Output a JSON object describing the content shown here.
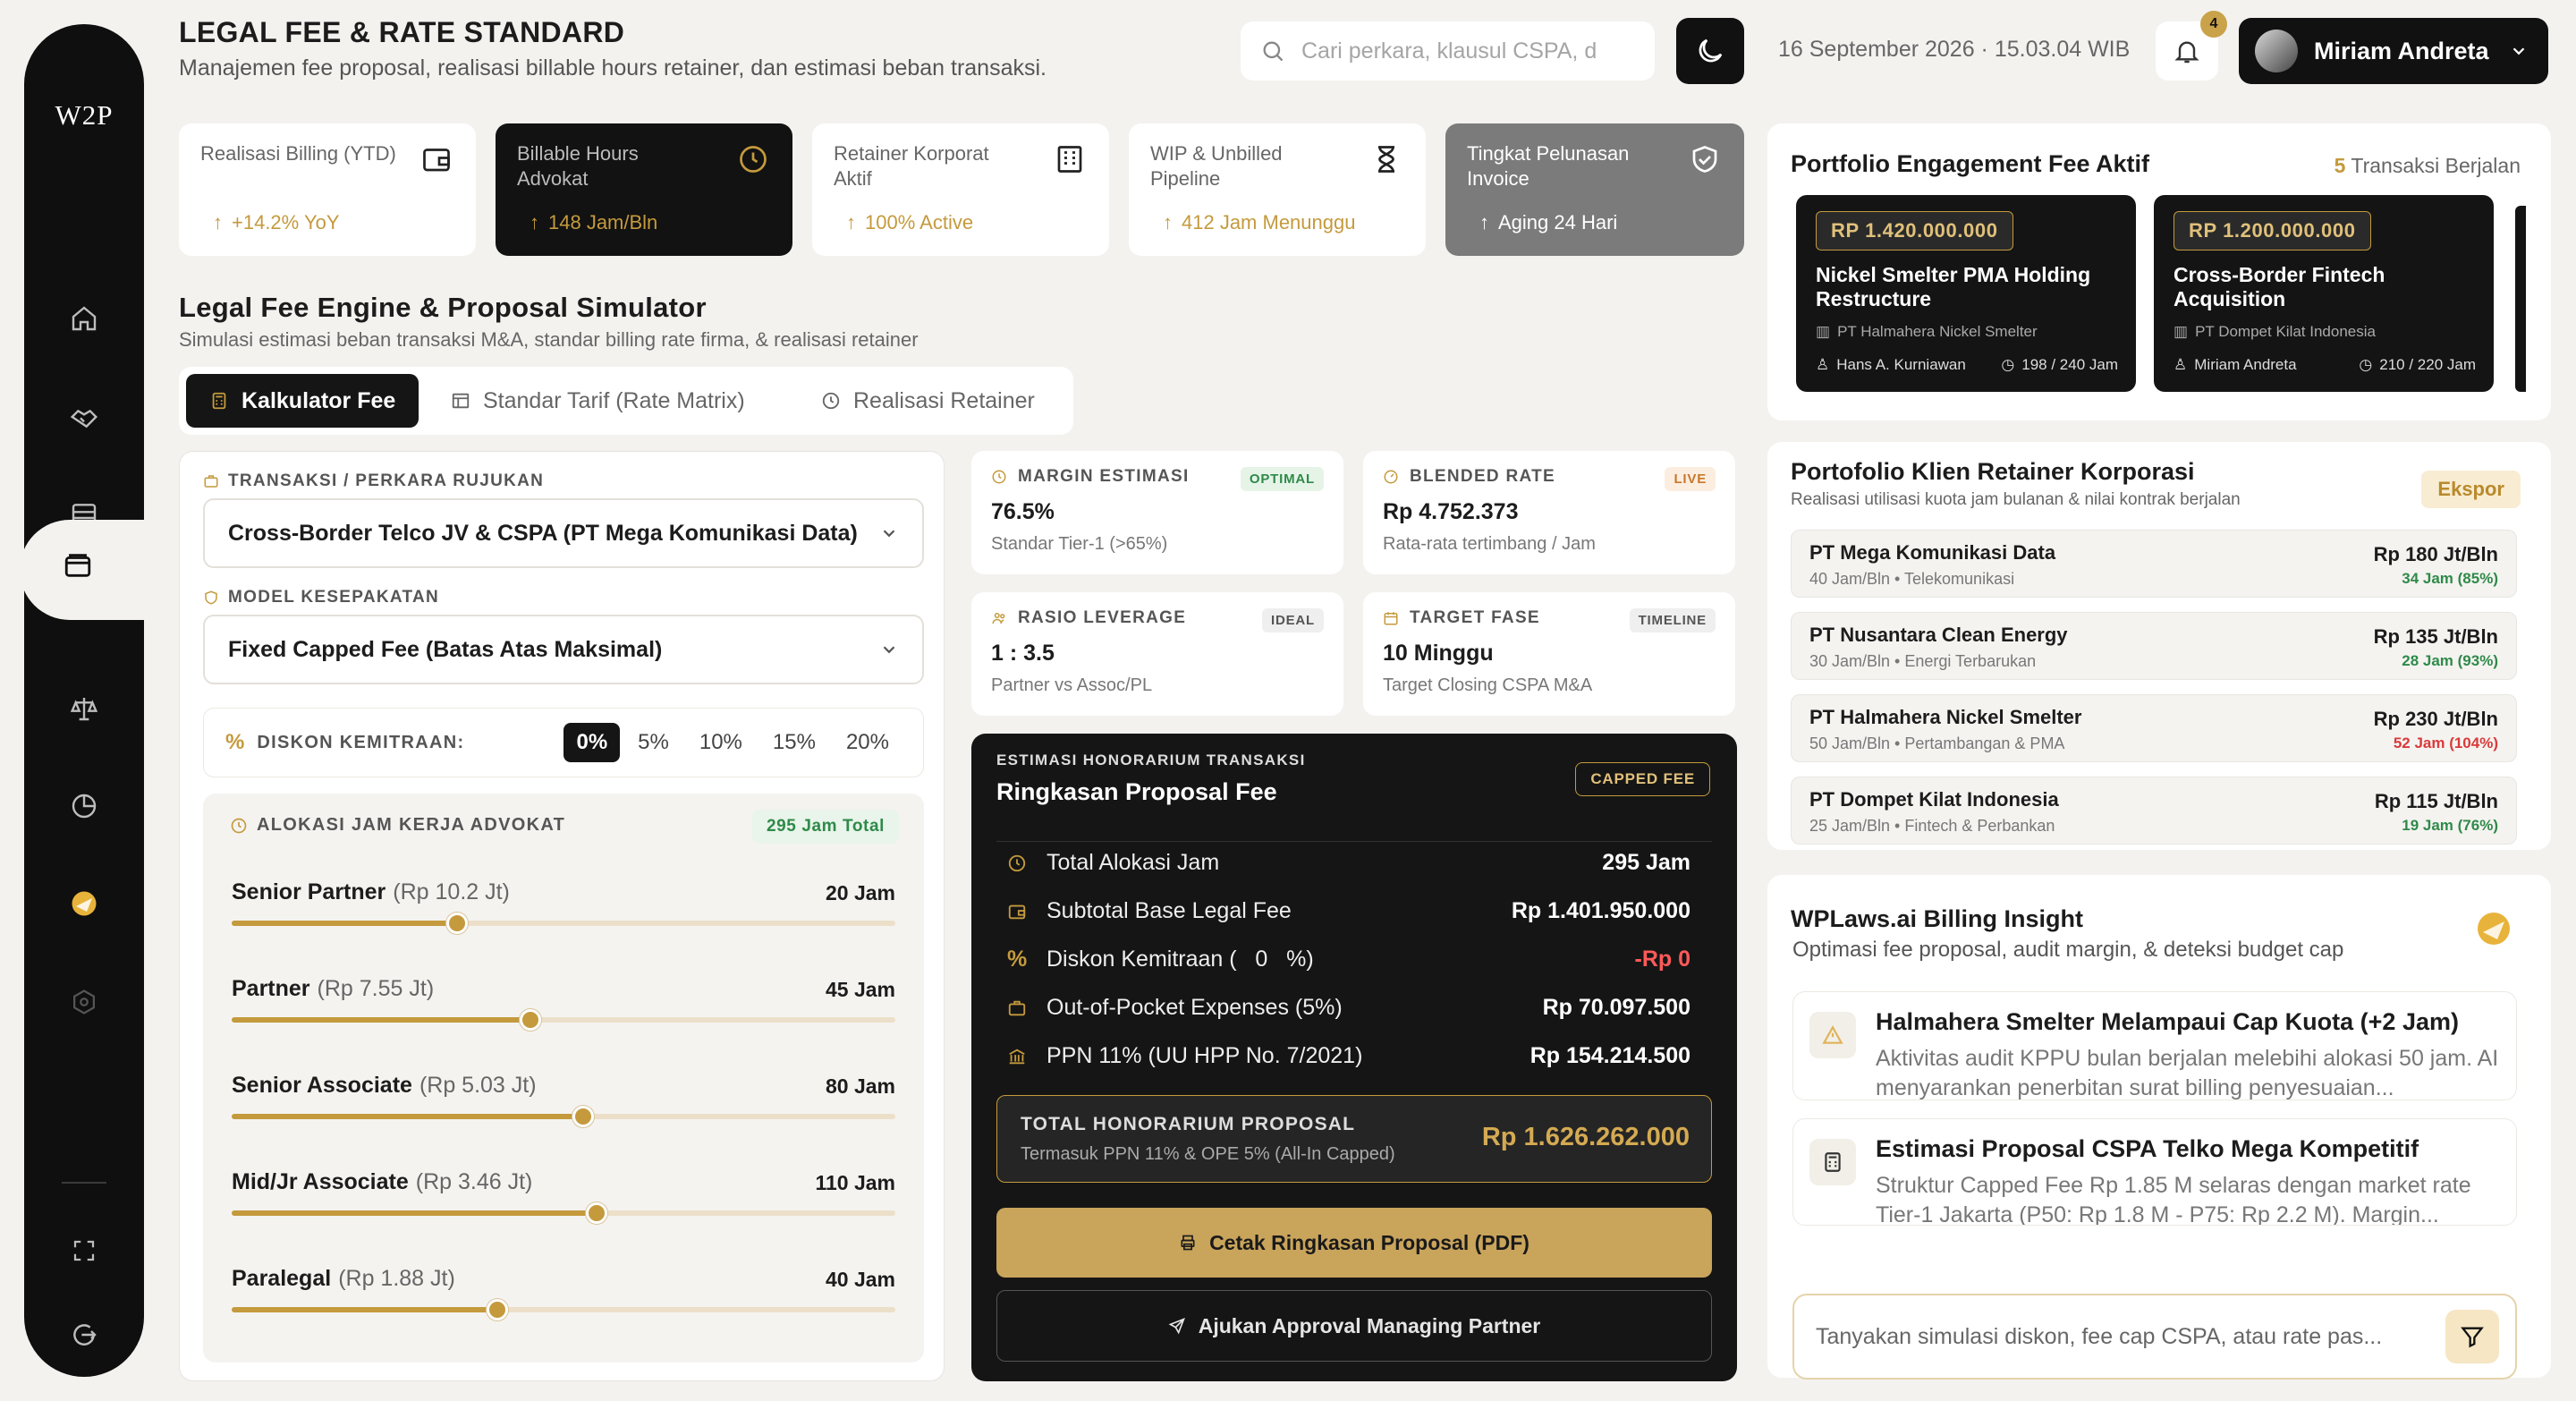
{
  "app": {
    "logo": "W2P"
  },
  "header": {
    "title": "LEGAL FEE & RATE STANDARD",
    "subtitle": "Manajemen fee proposal, realisasi billable hours retainer, dan estimasi beban transaksi.",
    "search_placeholder": "Cari perkara, klausul CSPA, d",
    "datetime": "16 September 2026 · 15.03.04 WIB",
    "notif_count": "4",
    "user_name": "Miriam Andreta"
  },
  "kpis": [
    {
      "label": "Realisasi Billing (YTD)",
      "value": "+14.2% YoY",
      "icon": "wallet-icon"
    },
    {
      "label": "Billable Hours Advokat",
      "value": "148 Jam/Bln",
      "icon": "clock-icon"
    },
    {
      "label": "Retainer Korporat Aktif",
      "value": "100% Active",
      "icon": "building-icon"
    },
    {
      "label": "WIP & Unbilled Pipeline",
      "value": "412 Jam Menunggu",
      "icon": "hourglass-icon"
    },
    {
      "label": "Tingkat Pelunasan Invoice",
      "value": "Aging 24 Hari",
      "icon": "shield-check-icon"
    }
  ],
  "engine": {
    "title": "Legal Fee Engine & Proposal Simulator",
    "subtitle": "Simulasi estimasi beban transaksi M&A, standar billing rate firma, & realisasi retainer",
    "tabs": [
      {
        "label": "Kalkulator Fee",
        "active": true
      },
      {
        "label": "Standar Tarif (Rate Matrix)",
        "active": false
      },
      {
        "label": "Realisasi Retainer",
        "active": false
      }
    ]
  },
  "form": {
    "transaction_label": "TRANSAKSI / PERKARA RUJUKAN",
    "transaction_value": "Cross-Border Telco JV & CSPA (PT Mega Komunikasi Data)",
    "model_label": "MODEL KESEPAKATAN",
    "model_value": "Fixed Capped Fee (Batas Atas Maksimal)",
    "discount_label": "DISKON KEMITRAAN:",
    "discount_options": [
      "0%",
      "5%",
      "10%",
      "15%",
      "20%"
    ],
    "discount_selected": "0%",
    "alloc_label": "ALOKASI JAM KERJA ADVOKAT",
    "alloc_total": "295 Jam Total",
    "roles": [
      {
        "name": "Senior Partner",
        "rate": "(Rp 10.2 Jt)",
        "hours": "20 Jam",
        "level": 0.34
      },
      {
        "name": "Partner",
        "rate": "(Rp 7.55 Jt)",
        "hours": "45 Jam",
        "level": 0.45
      },
      {
        "name": "Senior Associate",
        "rate": "(Rp 5.03 Jt)",
        "hours": "80 Jam",
        "level": 0.53
      },
      {
        "name": "Mid/Jr Associate",
        "rate": "(Rp 3.46 Jt)",
        "hours": "110 Jam",
        "level": 0.55
      },
      {
        "name": "Paralegal",
        "rate": "(Rp 1.88 Jt)",
        "hours": "40 Jam",
        "level": 0.4
      }
    ]
  },
  "metrics": [
    {
      "label": "MARGIN ESTIMASI",
      "badge": "OPTIMAL",
      "value": "76.5%",
      "sub": "Standar Tier-1 (>65%)"
    },
    {
      "label": "BLENDED RATE",
      "badge": "LIVE",
      "value": "Rp 4.752.373",
      "sub": "Rata-rata tertimbang / Jam"
    },
    {
      "label": "RASIO LEVERAGE",
      "badge": "IDEAL",
      "value": "1 : 3.5",
      "sub": "Partner vs Assoc/PL"
    },
    {
      "label": "TARGET FASE",
      "badge": "TIMELINE",
      "value": "10 Minggu",
      "sub": "Target Closing CSPA M&A"
    }
  ],
  "summary": {
    "kicker": "ESTIMASI HONORARIUM TRANSAKSI",
    "title": "Ringkasan Proposal Fee",
    "badge": "CAPPED FEE",
    "rows": [
      {
        "label": "Total Alokasi Jam",
        "value": "295 Jam",
        "icon": "clock-icon"
      },
      {
        "label": "Subtotal Base Legal Fee",
        "value": "Rp 1.401.950.000",
        "icon": "wallet-icon"
      },
      {
        "label": "Diskon Kemitraan (   0   %)",
        "value": "-Rp 0",
        "icon": "percent-icon"
      },
      {
        "label": "Out-of-Pocket Expenses (5%)",
        "value": "Rp 70.097.500",
        "icon": "briefcase-icon"
      },
      {
        "label": "PPN 11% (UU HPP No. 7/2021)",
        "value": "Rp 154.214.500",
        "icon": "bank-icon"
      }
    ],
    "total_label": "TOTAL HONORARIUM PROPOSAL",
    "total_sub": "Termasuk PPN 11% & OPE 5% (All-In Capped)",
    "total_value": "Rp 1.626.262.000",
    "print_button": "Cetak Ringkasan Proposal (PDF)",
    "approve_button": "Ajukan Approval Managing Partner"
  },
  "portfolio": {
    "title": "Portfolio Engagement Fee Aktif",
    "count": "5",
    "count_suffix": "Transaksi Berjalan",
    "items": [
      {
        "price": "RP 1.420.000.000",
        "title": "Nickel Smelter PMA Holding Restructure",
        "client": "PT Halmahera Nickel Smelter",
        "person": "Hans A. Kurniawan",
        "hours": "198 / 240 Jam"
      },
      {
        "price": "RP 1.200.000.000",
        "title": "Cross-Border Fintech Acquisition",
        "client": "PT Dompet Kilat Indonesia",
        "person": "Miriam Andreta",
        "hours": "210 / 220 Jam"
      }
    ]
  },
  "retainer": {
    "title": "Portofolio Klien Retainer Korporasi",
    "subtitle": "Realisasi utilisasi kuota jam bulanan & nilai kontrak berjalan",
    "export": "Ekspor",
    "clients": [
      {
        "name": "PT Mega Komunikasi Data",
        "sub": "40 Jam/Bln • Telekomunikasi",
        "rate": "Rp 180 Jt/Bln",
        "usage": "34 Jam (85%)",
        "status": "ok"
      },
      {
        "name": "PT Nusantara Clean Energy",
        "sub": "30 Jam/Bln • Energi Terbarukan",
        "rate": "Rp 135 Jt/Bln",
        "usage": "28 Jam (93%)",
        "status": "ok"
      },
      {
        "name": "PT Halmahera Nickel Smelter",
        "sub": "50 Jam/Bln • Pertambangan & PMA",
        "rate": "Rp 230 Jt/Bln",
        "usage": "52 Jam (104%)",
        "status": "over"
      },
      {
        "name": "PT Dompet Kilat Indonesia",
        "sub": "25 Jam/Bln • Fintech & Perbankan",
        "rate": "Rp 115 Jt/Bln",
        "usage": "19 Jam (76%)",
        "status": "ok"
      }
    ]
  },
  "insight": {
    "title": "WPLaws.ai Billing Insight",
    "subtitle": "Optimasi fee proposal, audit margin, & deteksi budget cap",
    "items": [
      {
        "title": "Halmahera Smelter Melampaui Cap Kuota (+2 Jam)",
        "desc": "Aktivitas audit KPPU bulan berjalan melebihi alokasi 50 jam. AI menyarankan penerbitan surat billing penyesuaian..."
      },
      {
        "title": "Estimasi Proposal CSPA Telko Mega Kompetitif",
        "desc": "Struktur Capped Fee Rp 1.85 M selaras dengan market rate Tier-1 Jakarta (P50: Rp 1.8 M - P75: Rp 2.2 M). Margin..."
      }
    ],
    "ask_placeholder": "Tanyakan simulasi diskon, fee cap CSPA, atau rate pas..."
  },
  "colors": {
    "gold": "#c49a3d",
    "dark": "#151515",
    "green": "#2f8a49",
    "red": "#d93a3a"
  }
}
